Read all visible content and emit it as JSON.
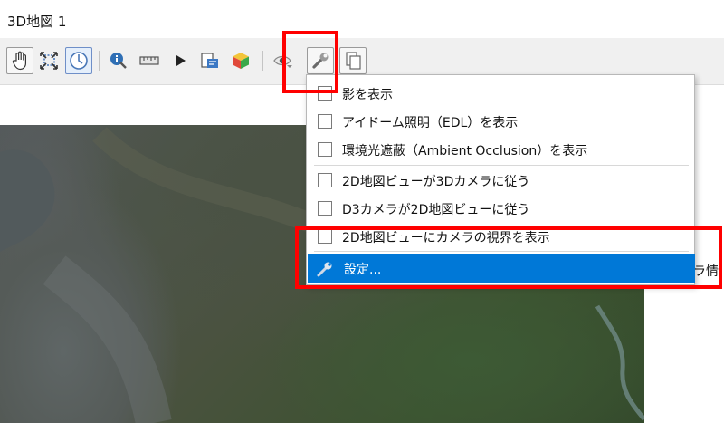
{
  "window": {
    "title": "3D地図 1"
  },
  "toolbar": {
    "buttons": [
      {
        "icon": "pan-hand-icon"
      },
      {
        "icon": "zoom-full-icon"
      },
      {
        "icon": "camera-control-icon"
      },
      {
        "icon": "identify-icon"
      },
      {
        "icon": "measure-icon"
      },
      {
        "icon": "play-icon"
      },
      {
        "icon": "export-scene-icon"
      },
      {
        "icon": "cube-icon"
      },
      {
        "icon": "view-eye-icon"
      },
      {
        "icon": "wrench-options-icon"
      },
      {
        "icon": "copy-icon"
      }
    ]
  },
  "options_menu": {
    "items": [
      {
        "label": "影を表示",
        "checked": false
      },
      {
        "label": "アイドーム照明（EDL）を表示",
        "checked": false
      },
      {
        "label": "環境光遮蔽（Ambient Occlusion）を表示",
        "checked": false
      },
      {
        "label": "2D地図ビューが3Dカメラに従う",
        "checked": false
      },
      {
        "label": "D3カメラが2D地図ビューに従う",
        "checked": false
      },
      {
        "label": "2D地図ビューにカメラの視界を表示",
        "checked": false
      }
    ],
    "settings": {
      "label": "設定..."
    }
  },
  "right_panel": {
    "text": "ラ情"
  },
  "colors": {
    "highlight": "#0078d7",
    "annotation": "#ff0000"
  }
}
